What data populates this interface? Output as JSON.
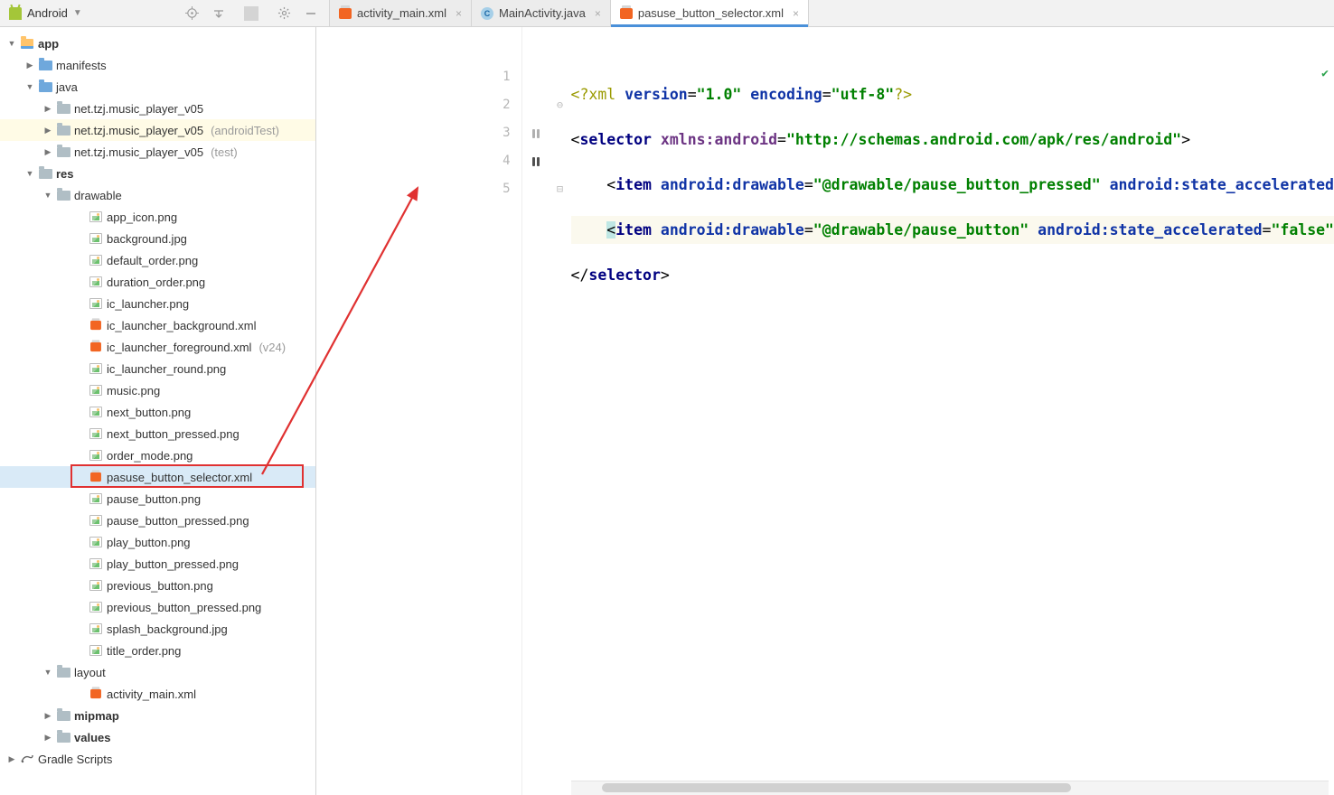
{
  "projectSelector": {
    "label": "Android"
  },
  "tabs": [
    {
      "label": "activity_main.xml",
      "iconType": "xml",
      "active": false
    },
    {
      "label": "MainActivity.java",
      "iconType": "java",
      "active": false
    },
    {
      "label": "pasuse_button_selector.xml",
      "iconType": "xml",
      "active": true
    }
  ],
  "tree": {
    "app": "app",
    "manifests": "manifests",
    "java": "java",
    "pkg1": {
      "label": "net.tzj.music_player_v05",
      "suffix": ""
    },
    "pkg2": {
      "label": "net.tzj.music_player_v05",
      "suffix": "(androidTest)"
    },
    "pkg3": {
      "label": "net.tzj.music_player_v05",
      "suffix": "(test)"
    },
    "res": "res",
    "drawable": "drawable",
    "files": [
      "app_icon.png",
      "background.jpg",
      "default_order.png",
      "duration_order.png",
      "ic_launcher.png",
      "ic_launcher_background.xml",
      "ic_launcher_foreground.xml",
      "ic_launcher_round.png",
      "music.png",
      "next_button.png",
      "next_button_pressed.png",
      "order_mode.png",
      "pasuse_button_selector.xml",
      "pause_button.png",
      "pause_button_pressed.png",
      "play_button.png",
      "play_button_pressed.png",
      "previous_button.png",
      "previous_button_pressed.png",
      "splash_background.jpg",
      "title_order.png"
    ],
    "file_suffix_v24_index": 6,
    "layout": "layout",
    "layout_file": "activity_main.xml",
    "mipmap": "mipmap",
    "values": "values",
    "gradle": "Gradle Scripts"
  },
  "code": {
    "l1": {
      "pi_open": "<?",
      "pi_name": "xml",
      "attr1": "version",
      "val1": "\"1.0\"",
      "attr2": "encoding",
      "val2": "\"utf-8\"",
      "pi_close": "?>"
    },
    "l2": {
      "tag": "selector",
      "attr": "xmlns:android",
      "val": "\"http://schemas.android.com/apk/res/android\""
    },
    "l3": {
      "tag": "item",
      "attr1": "android:drawable",
      "val1": "\"@drawable/pause_button_pressed\"",
      "attr2": "android:state_accelerated"
    },
    "l4": {
      "tag": "item",
      "attr1": "android:drawable",
      "val1": "\"@drawable/pause_button\"",
      "attr2": "android:state_accelerated",
      "val2": "\"false\""
    },
    "l5": {
      "tag": "selector"
    }
  },
  "lineNumbers": [
    "1",
    "2",
    "3",
    "4",
    "5"
  ]
}
